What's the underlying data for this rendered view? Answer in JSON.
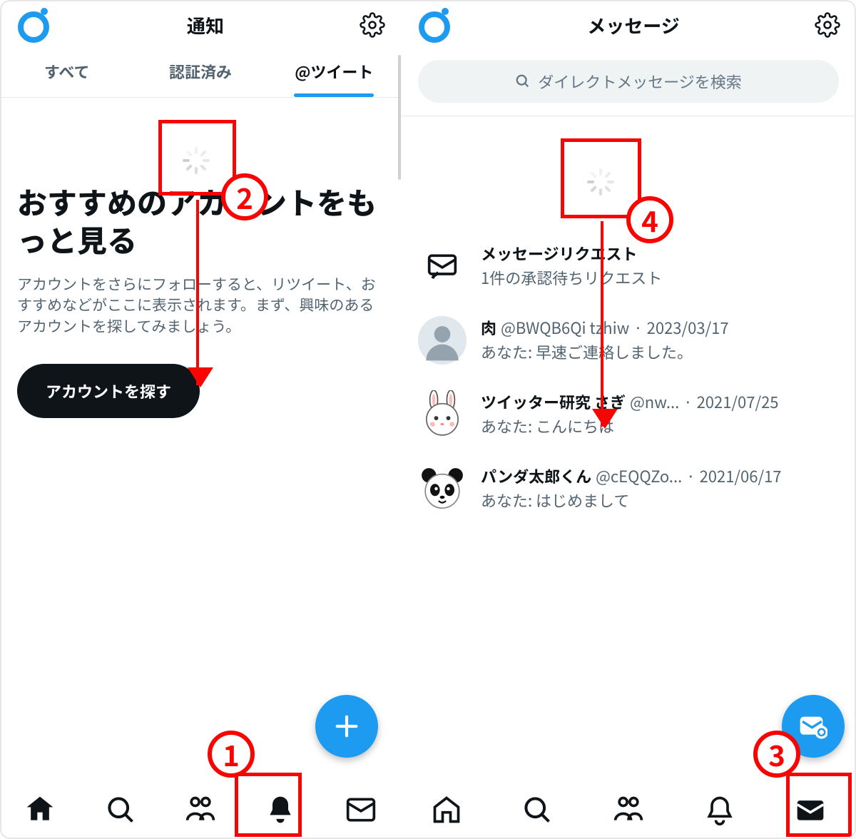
{
  "left": {
    "title": "通知",
    "tabs": [
      "すべて",
      "認証済み",
      "@ツイート"
    ],
    "activeTab": 2,
    "spinnerName": "loading-spinner",
    "empty": {
      "title": "おすすめのアカウントをもっと見る",
      "desc": "アカウントをさらにフォローすると、リツイート、おすすめなどがここに表示されます。まず、興味のあるアカウントを探してみましょう。",
      "cta": "アカウントを探す"
    },
    "nav": [
      "home",
      "search",
      "people",
      "bell",
      "mail"
    ],
    "navActive": 3
  },
  "right": {
    "title": "メッセージ",
    "searchPlaceholder": "ダイレクトメッセージを検索",
    "request": {
      "title": "メッセージリクエスト",
      "sub": "1件の承認待ちリクエスト"
    },
    "items": [
      {
        "avatar": "silhouette",
        "name": "肉",
        "handle": "@BWQB6Qi tzhiw",
        "date": "2023/03/17",
        "preview": "あなた: 早速ご連絡しました。"
      },
      {
        "avatar": "bunny",
        "name": "ツイッター研究 さぎ",
        "handle": "@nw...",
        "date": "2021/07/25",
        "preview": "あなた: こんにちは"
      },
      {
        "avatar": "panda",
        "name": "パンダ太郎くん",
        "handle": "@cEQQZo...",
        "date": "2021/06/17",
        "preview": "あなた: はじめまして"
      }
    ],
    "nav": [
      "home",
      "search",
      "people",
      "bell",
      "mail"
    ],
    "navActive": 4
  },
  "annotations": {
    "n1": "1",
    "n2": "2",
    "n3": "3",
    "n4": "4"
  },
  "colors": {
    "accent": "#1d9bf0",
    "annotation": "#f60502"
  }
}
